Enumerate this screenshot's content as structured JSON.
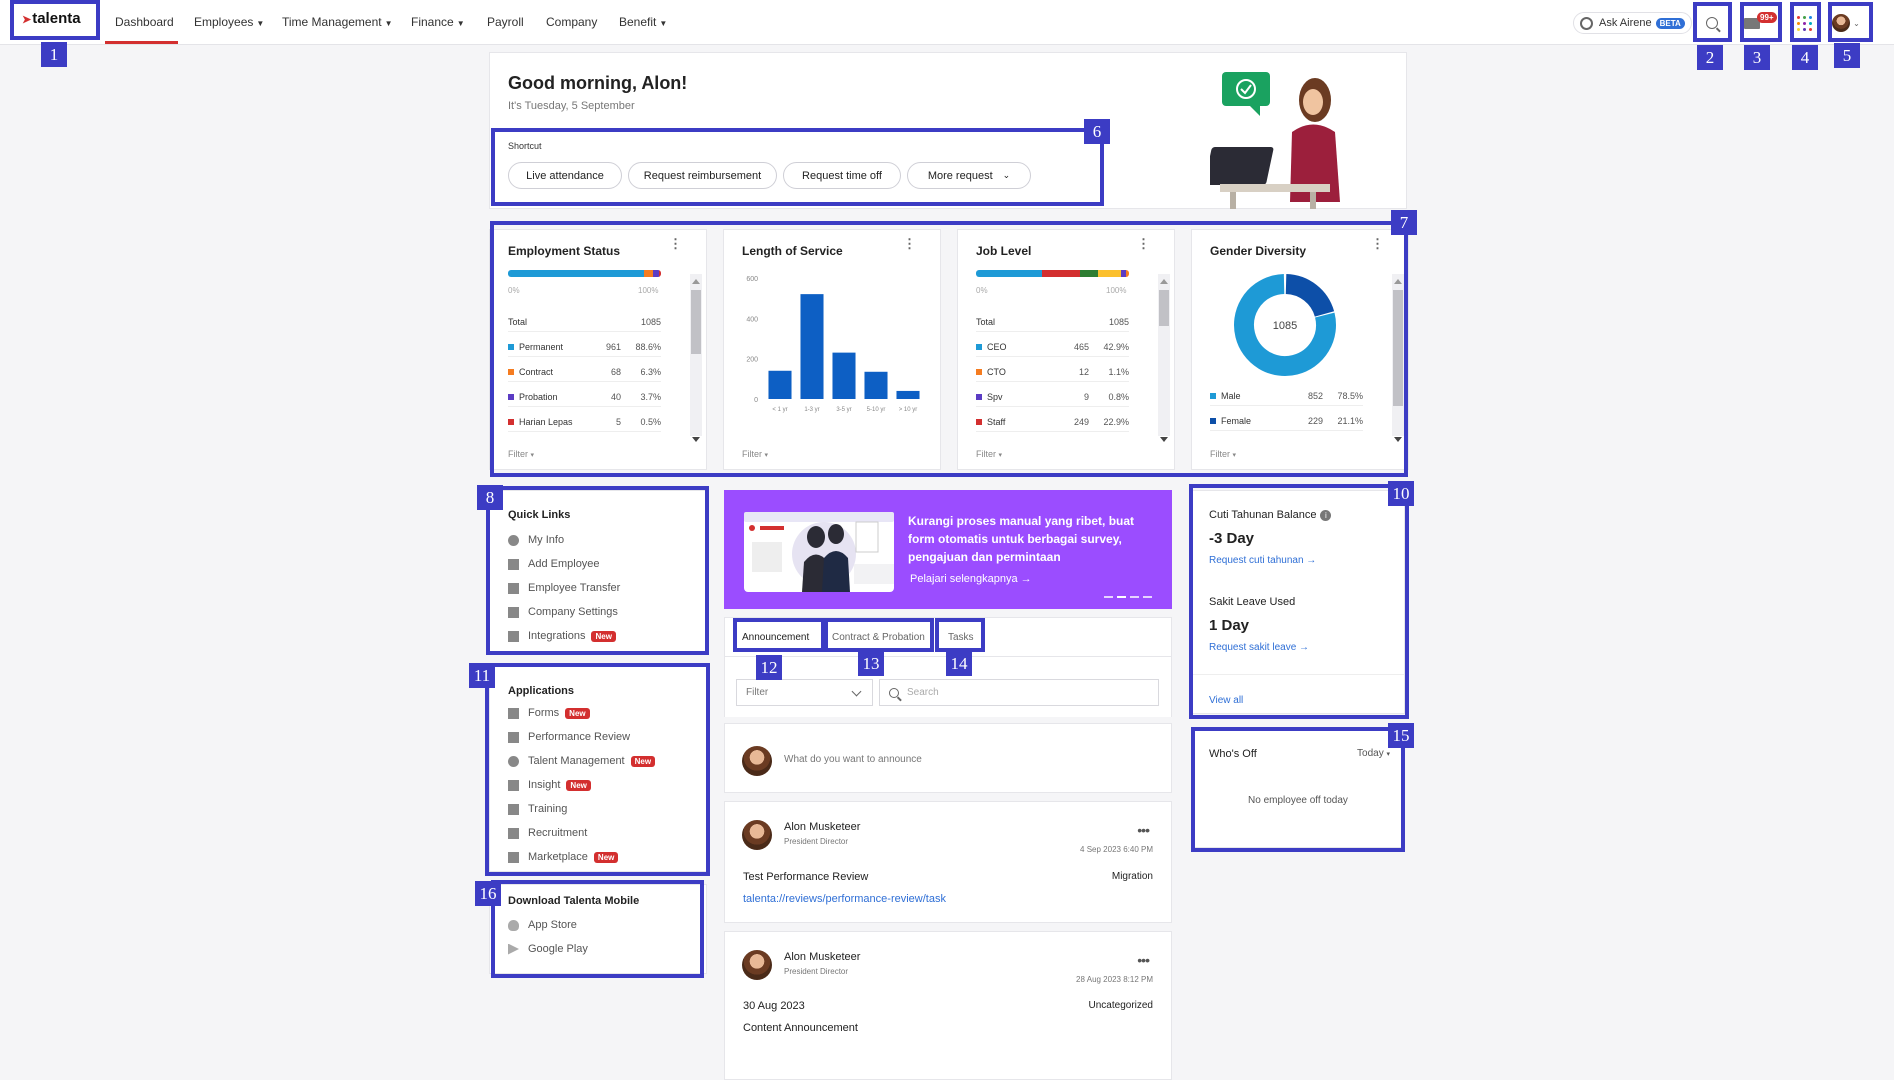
{
  "nav": {
    "logo": "talenta",
    "items": [
      "Dashboard",
      "Employees",
      "Time Management",
      "Finance",
      "Payroll",
      "Company",
      "Benefit"
    ],
    "ask_label": "Ask Airene",
    "beta": "BETA",
    "notif_badge": "99+"
  },
  "greeting": {
    "title": "Good morning, Alon!",
    "date": "It's Tuesday, 5 September",
    "shortcut_label": "Shortcut",
    "shortcuts": [
      "Live attendance",
      "Request reimbursement",
      "Request time off",
      "More request"
    ]
  },
  "widgets": {
    "employment": {
      "title": "Employment Status",
      "pct_min": "0%",
      "pct_max": "100%",
      "total_label": "Total",
      "total": "1085",
      "rows": [
        {
          "name": "Permanent",
          "count": "961",
          "pct": "88.6%",
          "color": "#1e9ad6"
        },
        {
          "name": "Contract",
          "count": "68",
          "pct": "6.3%",
          "color": "#f57c20"
        },
        {
          "name": "Probation",
          "count": "40",
          "pct": "3.7%",
          "color": "#5b3cc4"
        },
        {
          "name": "Harian Lepas",
          "count": "5",
          "pct": "0.5%",
          "color": "#d32f2f"
        }
      ],
      "filter": "Filter"
    },
    "service": {
      "title": "Length of Service",
      "filter": "Filter"
    },
    "joblevel": {
      "title": "Job Level",
      "pct_min": "0%",
      "pct_max": "100%",
      "total_label": "Total",
      "total": "1085",
      "rows": [
        {
          "name": "CEO",
          "count": "465",
          "pct": "42.9%",
          "color": "#1e9ad6"
        },
        {
          "name": "CTO",
          "count": "12",
          "pct": "1.1%",
          "color": "#f57c20"
        },
        {
          "name": "Spv",
          "count": "9",
          "pct": "0.8%",
          "color": "#5b3cc4"
        },
        {
          "name": "Staff",
          "count": "249",
          "pct": "22.9%",
          "color": "#d32f2f"
        }
      ],
      "filter": "Filter"
    },
    "gender": {
      "title": "Gender Diversity",
      "total": "1085",
      "rows": [
        {
          "name": "Male",
          "count": "852",
          "pct": "78.5%",
          "color": "#1e9ad6"
        },
        {
          "name": "Female",
          "count": "229",
          "pct": "21.1%",
          "color": "#0d4fa8"
        }
      ],
      "filter": "Filter"
    }
  },
  "chart_data": {
    "type": "bar",
    "categories": [
      "< 1 yr",
      "1-3 yr",
      "3-5 yr",
      "5-10 yr",
      "> 10 yr"
    ],
    "values": [
      140,
      520,
      230,
      135,
      40
    ],
    "yticks": [
      0,
      200,
      400,
      600
    ],
    "ylim": [
      0,
      600
    ],
    "color": "#0d5fc4"
  },
  "quick_links": {
    "title": "Quick Links",
    "items": [
      {
        "label": "My Info",
        "icon": "user-circle-icon"
      },
      {
        "label": "Add Employee",
        "icon": "user-plus-icon"
      },
      {
        "label": "Employee Transfer",
        "icon": "transfer-icon"
      },
      {
        "label": "Company Settings",
        "icon": "building-icon"
      },
      {
        "label": "Integrations",
        "icon": "puzzle-icon",
        "badge": "New"
      }
    ]
  },
  "applications": {
    "title": "Applications",
    "items": [
      {
        "label": "Forms",
        "icon": "form-icon",
        "badge": "New"
      },
      {
        "label": "Performance Review",
        "icon": "bar-chart-icon"
      },
      {
        "label": "Talent Management",
        "icon": "medal-icon",
        "badge": "New"
      },
      {
        "label": "Insight",
        "icon": "insight-icon",
        "badge": "New"
      },
      {
        "label": "Training",
        "icon": "book-icon"
      },
      {
        "label": "Recruitment",
        "icon": "briefcase-icon"
      },
      {
        "label": "Marketplace",
        "icon": "box-icon",
        "badge": "New"
      }
    ]
  },
  "download": {
    "title": "Download Talenta Mobile",
    "items": [
      {
        "label": "App Store",
        "icon": "apple-icon"
      },
      {
        "label": "Google Play",
        "icon": "play-icon"
      }
    ]
  },
  "banner": {
    "text": "Kurangi proses manual yang ribet, buat form otomatis untuk berbagai survey, pengajuan dan permintaan",
    "link": "Pelajari selengkapnya →"
  },
  "feed": {
    "tabs": [
      "Announcement",
      "Contract & Probation",
      "Tasks"
    ],
    "filter": "Filter",
    "search_placeholder": "Search",
    "announce_placeholder": "What do you want to announce",
    "posts": [
      {
        "name": "Alon Musketeer",
        "role": "President Director",
        "date": "4 Sep 2023 6:40 PM",
        "title": "Test Performance Review",
        "tag": "Migration",
        "body": "talenta://reviews/performance-review/task",
        "link": true
      },
      {
        "name": "Alon Musketeer",
        "role": "President Director",
        "date": "28 Aug 2023 8:12 PM",
        "title": "30 Aug 2023",
        "tag": "Uncategorized",
        "body": "Content Announcement",
        "link": false
      }
    ]
  },
  "leave": {
    "cuti_title": "Cuti Tahunan Balance",
    "cuti_value": "-3 Day",
    "cuti_link": "Request cuti tahunan →",
    "sakit_title": "Sakit Leave Used",
    "sakit_value": "1 Day",
    "sakit_link": "Request sakit leave →",
    "view_all": "View all"
  },
  "whos_off": {
    "title": "Who's Off",
    "range": "Today",
    "empty": "No employee off today"
  },
  "labels": [
    "1",
    "2",
    "3",
    "4",
    "5",
    "6",
    "7",
    "8",
    "10",
    "11",
    "12",
    "13",
    "14",
    "15",
    "16"
  ]
}
